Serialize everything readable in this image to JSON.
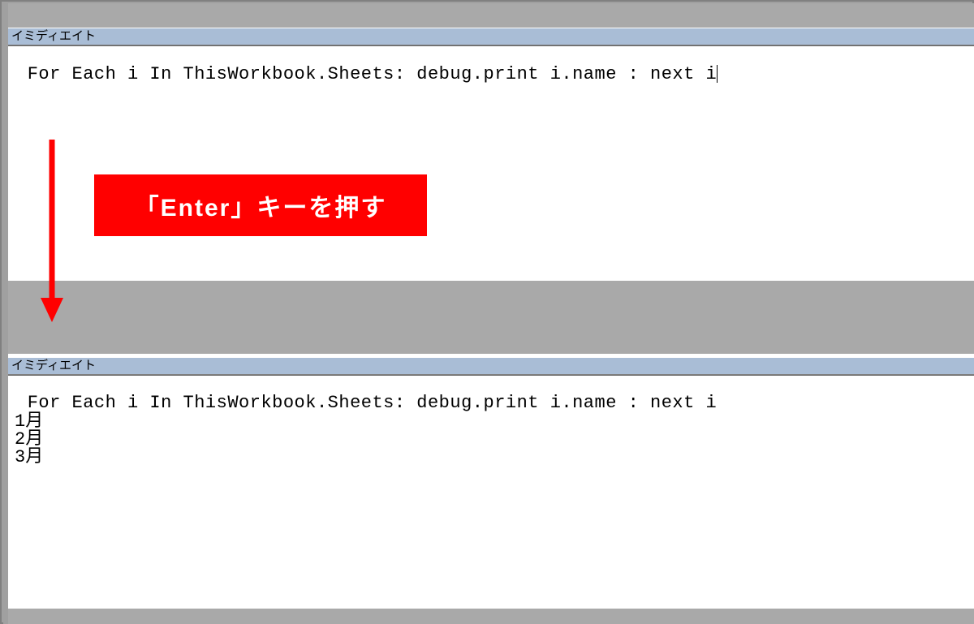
{
  "panel1": {
    "title": "イミディエイト",
    "code": " For Each i In ThisWorkbook.Sheets: debug.print i.name : next i"
  },
  "panel2": {
    "title": "イミディエイト",
    "code": " For Each i In ThisWorkbook.Sheets: debug.print i.name : next i",
    "output": [
      "1月",
      "2月",
      "3月"
    ]
  },
  "annotation": {
    "text": "「Enter」キーを押す"
  }
}
